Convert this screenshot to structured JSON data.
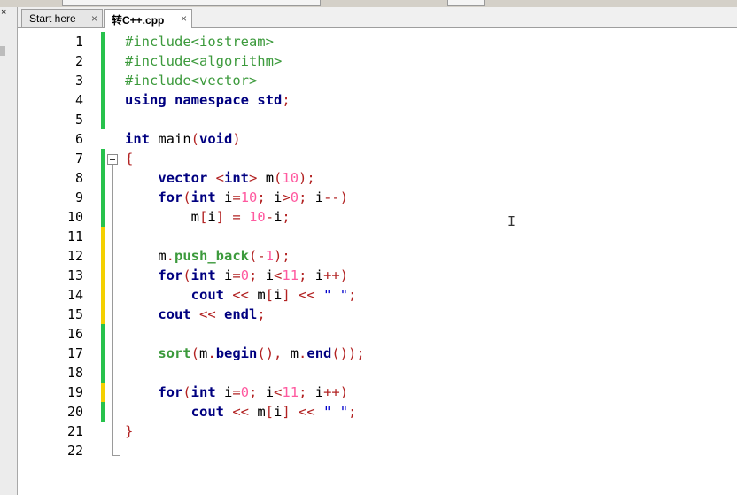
{
  "tabs": [
    {
      "label": "Start here",
      "close": "×"
    },
    {
      "label": "转C++.cpp",
      "close": "×"
    }
  ],
  "left_close": "×",
  "colors": {
    "change_saved": "#27c24c",
    "change_unsaved": "#f4d000"
  },
  "lines": [
    {
      "n": "1",
      "change": "green",
      "tokens": [
        [
          "pp",
          "#include<iostream>"
        ]
      ]
    },
    {
      "n": "2",
      "change": "green",
      "tokens": [
        [
          "pp",
          "#include<algorithm>"
        ]
      ]
    },
    {
      "n": "3",
      "change": "green",
      "tokens": [
        [
          "pp",
          "#include<vector>"
        ]
      ]
    },
    {
      "n": "4",
      "change": "green",
      "tokens": [
        [
          "kw",
          "using"
        ],
        [
          "t",
          " "
        ],
        [
          "kw",
          "namespace"
        ],
        [
          "t",
          " "
        ],
        [
          "kw",
          "std"
        ],
        [
          "op",
          ";"
        ]
      ]
    },
    {
      "n": "5",
      "change": "green",
      "tokens": []
    },
    {
      "n": "6",
      "change": "none",
      "tokens": [
        [
          "kw",
          "int"
        ],
        [
          "t",
          " main"
        ],
        [
          "op",
          "("
        ],
        [
          "kw",
          "void"
        ],
        [
          "op",
          ")"
        ]
      ]
    },
    {
      "n": "7",
      "change": "green",
      "tokens": [
        [
          "op",
          "{"
        ]
      ]
    },
    {
      "n": "8",
      "change": "green",
      "tokens": [
        [
          "t",
          "    "
        ],
        [
          "kw",
          "vector"
        ],
        [
          "t",
          " "
        ],
        [
          "op",
          "<"
        ],
        [
          "kw",
          "int"
        ],
        [
          "op",
          ">"
        ],
        [
          "t",
          " m"
        ],
        [
          "op",
          "("
        ],
        [
          "nm",
          "10"
        ],
        [
          "op",
          ");"
        ]
      ]
    },
    {
      "n": "9",
      "change": "green",
      "tokens": [
        [
          "t",
          "    "
        ],
        [
          "kw",
          "for"
        ],
        [
          "op",
          "("
        ],
        [
          "kw",
          "int"
        ],
        [
          "t",
          " i"
        ],
        [
          "op",
          "="
        ],
        [
          "nm",
          "10"
        ],
        [
          "op",
          ";"
        ],
        [
          "t",
          " i"
        ],
        [
          "op",
          ">"
        ],
        [
          "nm",
          "0"
        ],
        [
          "op",
          ";"
        ],
        [
          "t",
          " i"
        ],
        [
          "op",
          "--)"
        ]
      ]
    },
    {
      "n": "10",
      "change": "green",
      "tokens": [
        [
          "t",
          "        m"
        ],
        [
          "op",
          "["
        ],
        [
          "t",
          "i"
        ],
        [
          "op",
          "]"
        ],
        [
          "t",
          " "
        ],
        [
          "op",
          "="
        ],
        [
          "t",
          " "
        ],
        [
          "nm",
          "10"
        ],
        [
          "op",
          "-"
        ],
        [
          "t",
          "i"
        ],
        [
          "op",
          ";"
        ]
      ]
    },
    {
      "n": "11",
      "change": "yellow",
      "tokens": []
    },
    {
      "n": "12",
      "change": "yellow",
      "tokens": [
        [
          "t",
          "    m"
        ],
        [
          "op",
          "."
        ],
        [
          "fn",
          "push_back"
        ],
        [
          "op",
          "(-"
        ],
        [
          "nm",
          "1"
        ],
        [
          "op",
          ");"
        ]
      ]
    },
    {
      "n": "13",
      "change": "yellow",
      "tokens": [
        [
          "t",
          "    "
        ],
        [
          "kw",
          "for"
        ],
        [
          "op",
          "("
        ],
        [
          "kw",
          "int"
        ],
        [
          "t",
          " i"
        ],
        [
          "op",
          "="
        ],
        [
          "nm",
          "0"
        ],
        [
          "op",
          ";"
        ],
        [
          "t",
          " i"
        ],
        [
          "op",
          "<"
        ],
        [
          "nm",
          "11"
        ],
        [
          "op",
          ";"
        ],
        [
          "t",
          " i"
        ],
        [
          "op",
          "++)"
        ]
      ]
    },
    {
      "n": "14",
      "change": "yellow",
      "tokens": [
        [
          "t",
          "        "
        ],
        [
          "kw",
          "cout"
        ],
        [
          "t",
          " "
        ],
        [
          "op",
          "<<"
        ],
        [
          "t",
          " m"
        ],
        [
          "op",
          "["
        ],
        [
          "t",
          "i"
        ],
        [
          "op",
          "]"
        ],
        [
          "t",
          " "
        ],
        [
          "op",
          "<<"
        ],
        [
          "t",
          " "
        ],
        [
          "st",
          "\" \""
        ],
        [
          "op",
          ";"
        ]
      ]
    },
    {
      "n": "15",
      "change": "yellow",
      "tokens": [
        [
          "t",
          "    "
        ],
        [
          "kw",
          "cout"
        ],
        [
          "t",
          " "
        ],
        [
          "op",
          "<<"
        ],
        [
          "t",
          " "
        ],
        [
          "kw",
          "endl"
        ],
        [
          "op",
          ";"
        ]
      ]
    },
    {
      "n": "16",
      "change": "green",
      "tokens": []
    },
    {
      "n": "17",
      "change": "green",
      "tokens": [
        [
          "t",
          "    "
        ],
        [
          "fn",
          "sort"
        ],
        [
          "op",
          "("
        ],
        [
          "t",
          "m"
        ],
        [
          "op",
          "."
        ],
        [
          "kw",
          "begin"
        ],
        [
          "op",
          "(),"
        ],
        [
          "t",
          " m"
        ],
        [
          "op",
          "."
        ],
        [
          "kw",
          "end"
        ],
        [
          "op",
          "());"
        ]
      ]
    },
    {
      "n": "18",
      "change": "green",
      "tokens": []
    },
    {
      "n": "19",
      "change": "yellow",
      "tokens": [
        [
          "t",
          "    "
        ],
        [
          "kw",
          "for"
        ],
        [
          "op",
          "("
        ],
        [
          "kw",
          "int"
        ],
        [
          "t",
          " i"
        ],
        [
          "op",
          "="
        ],
        [
          "nm",
          "0"
        ],
        [
          "op",
          ";"
        ],
        [
          "t",
          " i"
        ],
        [
          "op",
          "<"
        ],
        [
          "nm",
          "11"
        ],
        [
          "op",
          ";"
        ],
        [
          "t",
          " i"
        ],
        [
          "op",
          "++)"
        ]
      ]
    },
    {
      "n": "20",
      "change": "green",
      "tokens": [
        [
          "t",
          "        "
        ],
        [
          "kw",
          "cout"
        ],
        [
          "t",
          " "
        ],
        [
          "op",
          "<<"
        ],
        [
          "t",
          " m"
        ],
        [
          "op",
          "["
        ],
        [
          "t",
          "i"
        ],
        [
          "op",
          "]"
        ],
        [
          "t",
          " "
        ],
        [
          "op",
          "<<"
        ],
        [
          "t",
          " "
        ],
        [
          "st",
          "\" \""
        ],
        [
          "op",
          ";"
        ]
      ]
    },
    {
      "n": "21",
      "change": "none",
      "tokens": [
        [
          "op",
          "}"
        ]
      ]
    },
    {
      "n": "22",
      "change": "none",
      "tokens": []
    }
  ],
  "text_cursor": "I"
}
